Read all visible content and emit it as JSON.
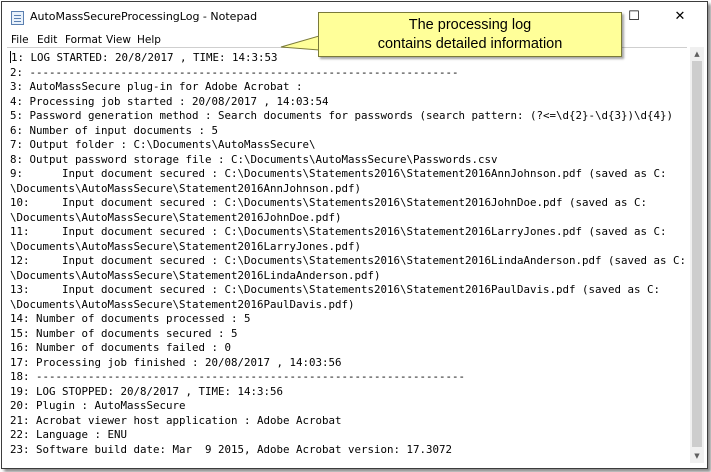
{
  "window": {
    "title": "AutoMassSecureProcessingLog - Notepad",
    "minimize_glyph": "—",
    "maximize_glyph": "☐",
    "close_glyph": "✕"
  },
  "menu": {
    "items": [
      "File",
      "Edit",
      "Format",
      "View",
      "Help"
    ]
  },
  "callout": {
    "line1": "The processing log",
    "line2": "contains detailed  information",
    "fill_color": "#ffff99"
  },
  "log_lines": [
    "1: LOG STARTED: 20/8/2017 , TIME: 14:3:53",
    "2: ------------------------------------------------------------------",
    "3: AutoMassSecure plug-in for Adobe Acrobat :",
    "4: Processing job started : 20/08/2017 , 14:03:54",
    "5: Password generation method : Search documents for passwords (search pattern: (?<=\\d{2}-\\d{3})\\d{4})",
    "6: Number of input documents : 5",
    "7: Output folder : C:\\Documents\\AutoMassSecure\\",
    "8: Output password storage file : C:\\Documents\\AutoMassSecure\\Passwords.csv",
    "9:      Input document secured : C:\\Documents\\Statements2016\\Statement2016AnnJohnson.pdf (saved as C:",
    "\\Documents\\AutoMassSecure\\Statement2016AnnJohnson.pdf)",
    "10:     Input document secured : C:\\Documents\\Statements2016\\Statement2016JohnDoe.pdf (saved as C:",
    "\\Documents\\AutoMassSecure\\Statement2016JohnDoe.pdf)",
    "11:     Input document secured : C:\\Documents\\Statements2016\\Statement2016LarryJones.pdf (saved as C:",
    "\\Documents\\AutoMassSecure\\Statement2016LarryJones.pdf)",
    "12:     Input document secured : C:\\Documents\\Statements2016\\Statement2016LindaAnderson.pdf (saved as C:",
    "\\Documents\\AutoMassSecure\\Statement2016LindaAnderson.pdf)",
    "13:     Input document secured : C:\\Documents\\Statements2016\\Statement2016PaulDavis.pdf (saved as C:",
    "\\Documents\\AutoMassSecure\\Statement2016PaulDavis.pdf)",
    "14: Number of documents processed : 5",
    "15: Number of documents secured : 5",
    "16: Number of documents failed : 0",
    "17: Processing job finished : 20/08/2017 , 14:03:56",
    "18: ------------------------------------------------------------------",
    "19: LOG STOPPED: 20/8/2017 , TIME: 14:3:56",
    "20: Plugin : AutoMassSecure",
    "21: Acrobat viewer host application : Adobe Acrobat",
    "22: Language : ENU",
    "23: Software build date: Mar  9 2015, Adobe Acrobat version: 17.3072"
  ]
}
